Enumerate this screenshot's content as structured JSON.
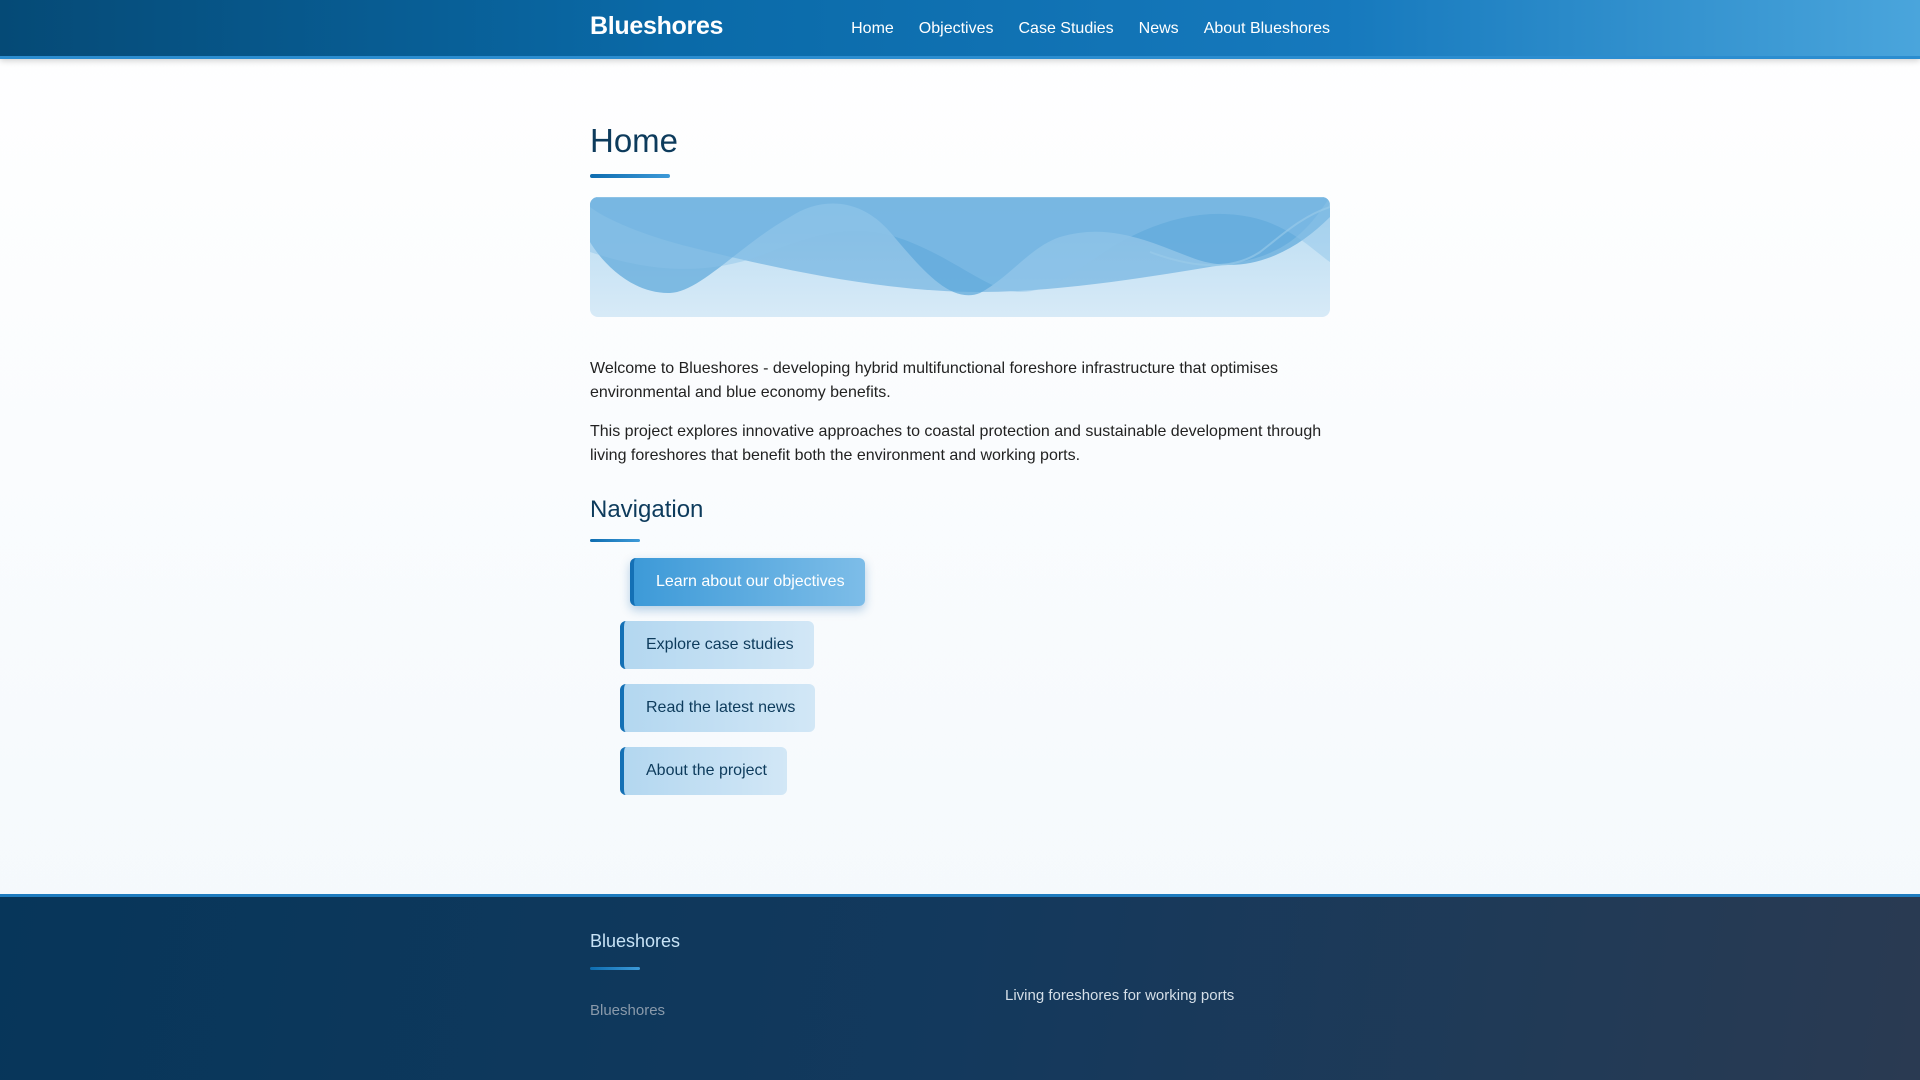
{
  "header": {
    "brand": "Blueshores",
    "nav": [
      "Home",
      "Objectives",
      "Case Studies",
      "News",
      "About Blueshores"
    ]
  },
  "main": {
    "title": "Home",
    "paragraphs": [
      "Welcome to Blueshores - developing hybrid multifunctional foreshore infrastructure that optimises environmental and blue economy benefits.",
      "This project explores innovative approaches to coastal protection and sustainable development through living foreshores that benefit both the environment and working ports."
    ],
    "navigation": {
      "title": "Navigation",
      "buttons": [
        "Learn about our objectives",
        "Explore case studies",
        "Read the latest news",
        "About the project"
      ]
    }
  },
  "footer": {
    "title": "Blueshores",
    "brand_link": "Blueshores",
    "tagline": "Living foreshores for working ports"
  },
  "colors": {
    "header_start": "#054a76",
    "header_end": "#4aa5dc",
    "heading": "#0d3b5c",
    "button_bg": "#b3d7f0",
    "button_active_bg": "#3d9ad8",
    "button_border": "#1470b5",
    "footer_bg": "#07365a"
  }
}
